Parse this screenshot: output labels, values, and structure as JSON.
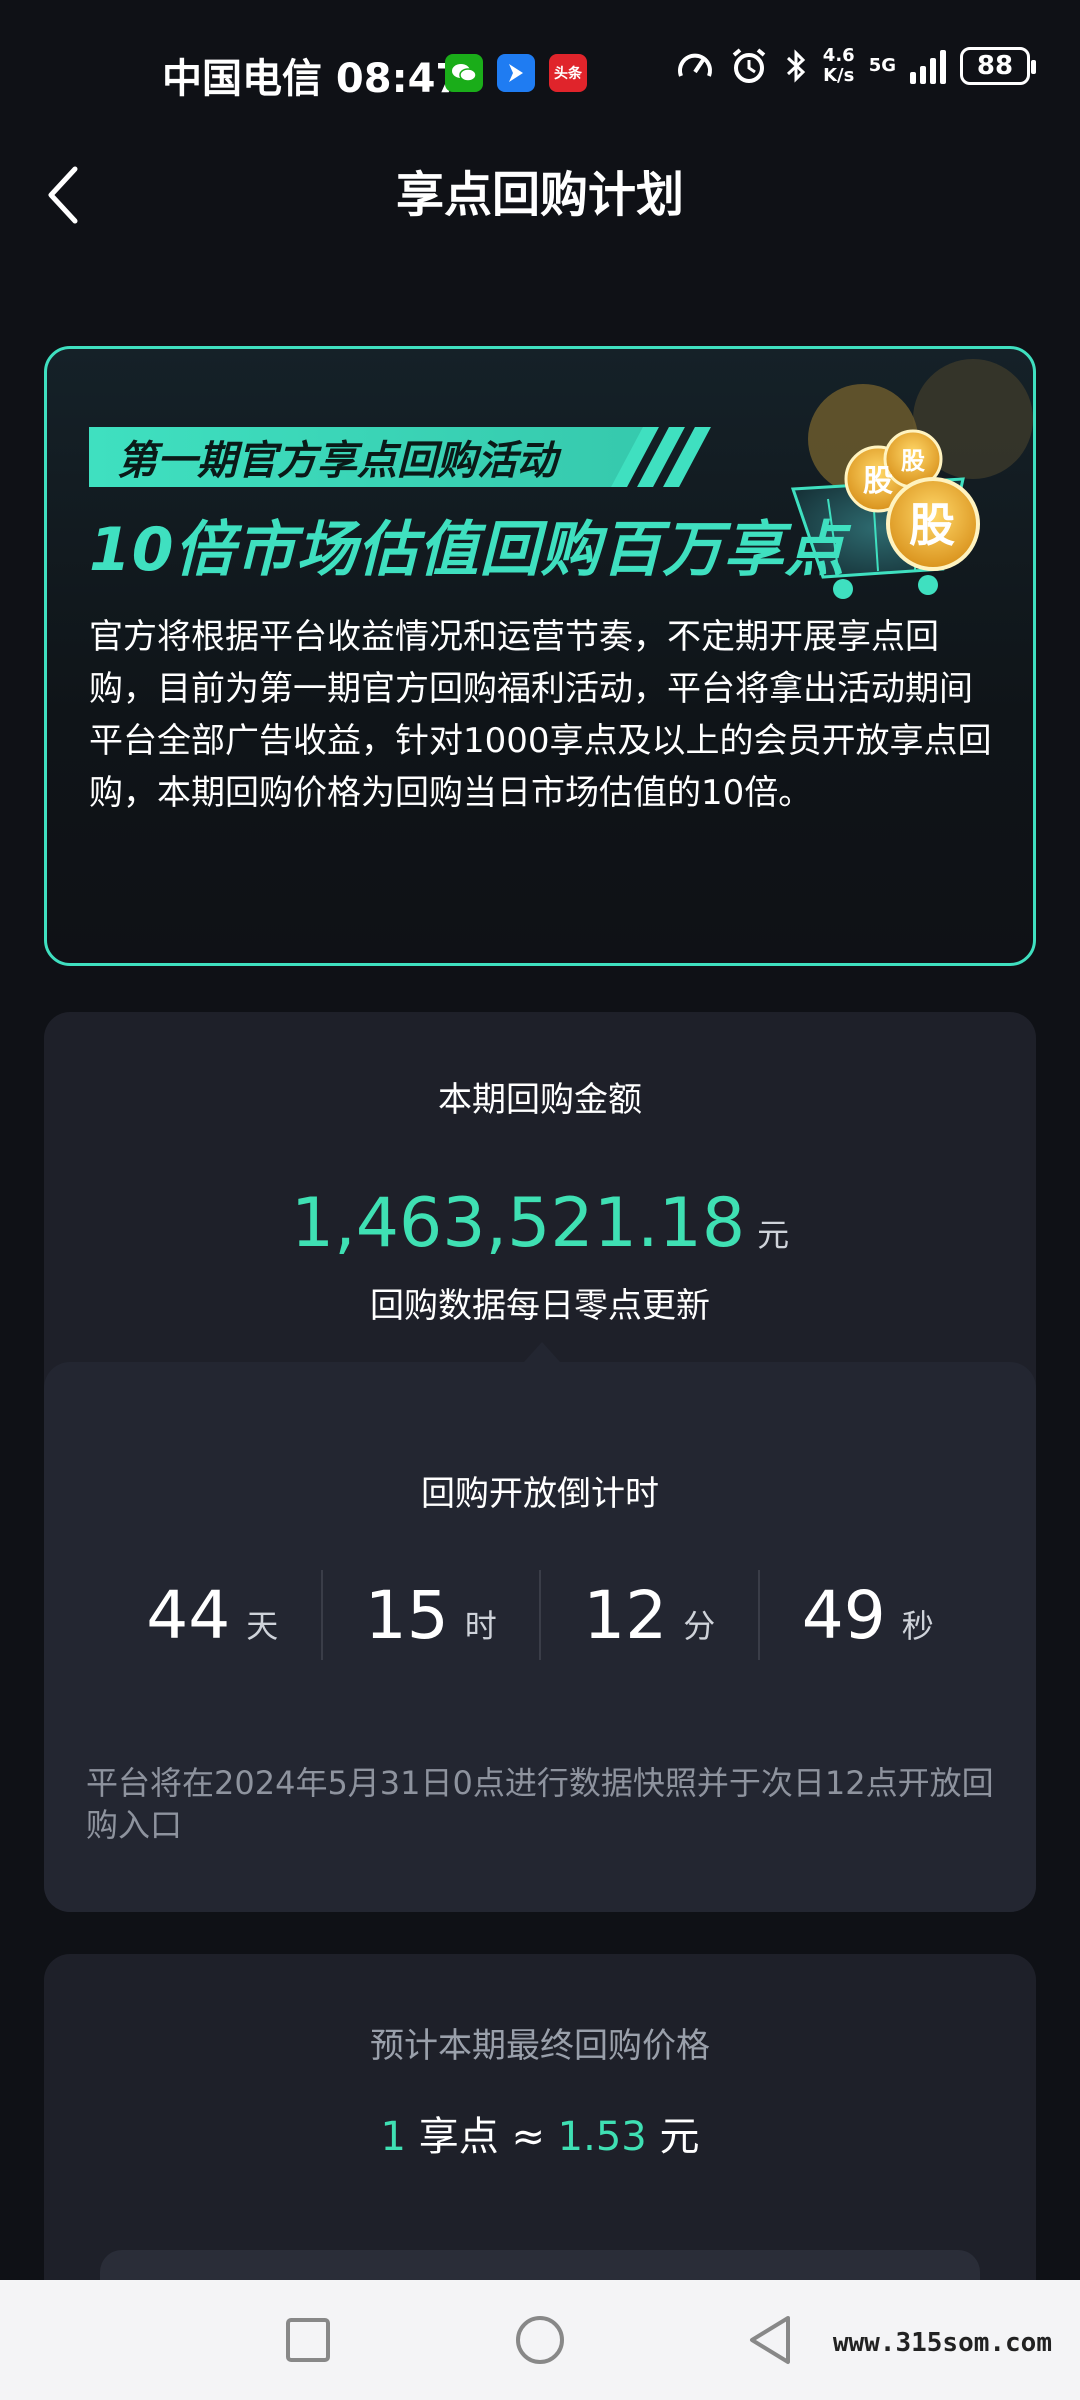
{
  "status_bar": {
    "carrier_time": "中国电信 08:47",
    "app_icons": [
      "wechat-icon",
      "blue-app-icon",
      "toutiao-icon"
    ],
    "toutiao_label": "头条",
    "speed_top": "4.6",
    "speed_bottom": "K/s",
    "network": "5G",
    "battery": "88"
  },
  "header": {
    "title": "享点回购计划",
    "back_icon": "chevron-left-icon"
  },
  "promo": {
    "tag": "第一期官方享点回购活动",
    "headline": "10倍市场估值回购百万享点",
    "coin_label": "股",
    "body": "官方将根据平台收益情况和运营节奏，不定期开展享点回购，目前为第一期官方回购福利活动，平台将拿出活动期间平台全部广告收益，针对1000享点及以上的会员开放享点回购，本期回购价格为回购当日市场估值的10倍。"
  },
  "amount": {
    "title": "本期回购金额",
    "value": "1,463,521.18",
    "unit": "元",
    "note": "回购数据每日零点更新"
  },
  "countdown": {
    "title": "回购开放倒计时",
    "units": [
      {
        "value": "44",
        "label": "天"
      },
      {
        "value": "15",
        "label": "时"
      },
      {
        "value": "12",
        "label": "分"
      },
      {
        "value": "49",
        "label": "秒"
      }
    ],
    "note": "平台将在2024年5月31日0点进行数据快照并于次日12点开放回购入口"
  },
  "price": {
    "title": "预计本期最终回购价格",
    "points": "1",
    "points_label": "享点",
    "approx": "≈",
    "value": "1.53",
    "unit": "元"
  },
  "navbar": {
    "buttons": [
      "recent-apps-icon",
      "home-icon",
      "back-icon"
    ],
    "watermark": "www.315som.com"
  },
  "colors": {
    "accent": "#3fe0b3",
    "background": "#0f1116",
    "card": "#1e2029"
  }
}
